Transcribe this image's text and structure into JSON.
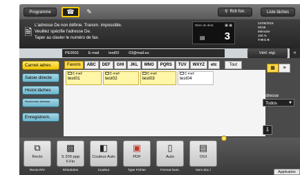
{
  "topbar": {
    "program_label": "Programme",
    "search_label": "Rch fon.",
    "jobs_label": "Liste tâches"
  },
  "message": {
    "line1": "L'adresse De non définie. Transm. impossible.",
    "line2": "Veuillez spécifie l'adresse De.",
    "line3": "Taper au clavier le numéro de fax."
  },
  "destination": {
    "label": "Nbre de dest.",
    "count": "3"
  },
  "status": {
    "date": "21/05/2015",
    "time": "08:58",
    "memory_label": "Mémoire",
    "memory_value": "100 %",
    "ymck": "Y M C K"
  },
  "address_row": {
    "items": [
      "PE0003",
      "E-mail",
      "test03",
      "03@mail.eu"
    ],
    "verify_label": "Vérif. régl."
  },
  "leftnav": {
    "items": [
      {
        "label": "Carnet adres"
      },
      {
        "label": "Saisie directe"
      },
      {
        "label": "Histor.tâches"
      },
      {
        "label": "Rechercher Adresse"
      },
      {
        "label": "Enregistrem."
      }
    ]
  },
  "tabs": [
    "Favoris",
    "ABC",
    "DEF",
    "GHI",
    "JKL",
    "MNO",
    "PQRS",
    "TUV",
    "WXYZ",
    "etc",
    "Tout"
  ],
  "entries": [
    {
      "type": "E-mail",
      "name": "test01"
    },
    {
      "type": "E-mail",
      "name": "test02"
    },
    {
      "type": "E-mail",
      "name": "test03"
    },
    {
      "type": "E-mail",
      "name": "test04"
    }
  ],
  "address_filter": {
    "label": "Adresse",
    "value": "Todos"
  },
  "functions": [
    {
      "icon": "recto-icon",
      "value": "Recto",
      "label": "Recto-R/V"
    },
    {
      "icon": "resolution-icon",
      "value": "S 200 ppp F.Fin",
      "label": "Résolution"
    },
    {
      "icon": "color-icon",
      "value": "Couleur Auto",
      "label": "Couleur"
    },
    {
      "icon": "pdf-icon",
      "value": "PDF",
      "label": "Type Fichier"
    },
    {
      "icon": "format-icon",
      "value": "Auto",
      "label": "Format Num."
    },
    {
      "icon": "docs-icon",
      "value": "OUI",
      "label": "Nom doc./"
    }
  ],
  "application_label": "Application"
}
